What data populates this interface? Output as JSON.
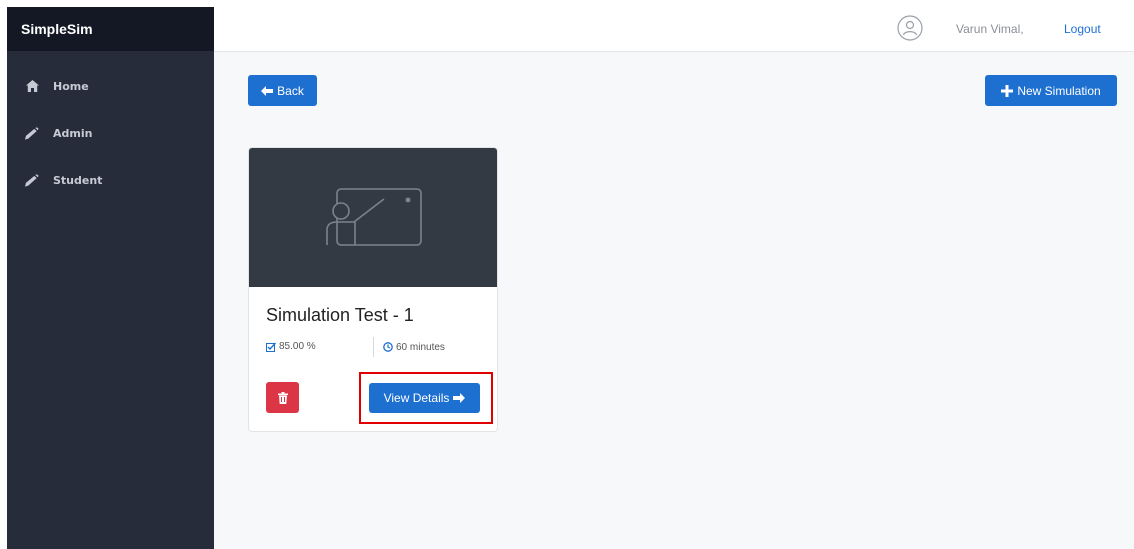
{
  "app": {
    "brand": "SimpleSim"
  },
  "sidebar": {
    "items": [
      {
        "label": "Home",
        "icon": "home-icon"
      },
      {
        "label": "Admin",
        "icon": "pencil-icon"
      },
      {
        "label": "Student",
        "icon": "pencil-icon"
      }
    ]
  },
  "header": {
    "user_name": "Varun Vimal,",
    "logout_label": "Logout",
    "avatar_icon": "user-avatar-icon"
  },
  "toolbar": {
    "back_label": "Back",
    "new_simulation_label": "New Simulation"
  },
  "card": {
    "title": "Simulation Test - 1",
    "score": "85.00 %",
    "duration": "60 minutes",
    "view_details_label": "View Details",
    "media_icon": "presentation-board-icon"
  },
  "colors": {
    "primary": "#1d6fd0",
    "danger": "#dc3545",
    "sidebar_bg": "#272c3a",
    "brand_bg": "#141824",
    "highlight": "#e00000"
  }
}
